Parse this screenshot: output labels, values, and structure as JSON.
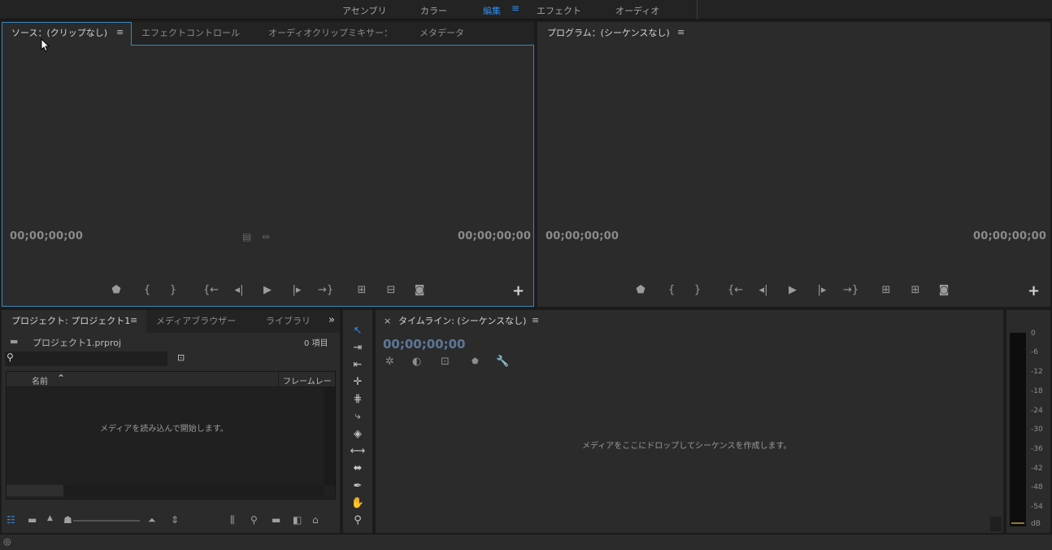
{
  "workspaces": {
    "tabs": [
      "アセンブリ",
      "カラー",
      "編集",
      "エフェクト",
      "オーディオ"
    ],
    "active": "編集",
    "menu_icon": "hamburger-icon"
  },
  "source_monitor": {
    "tabs": [
      "ソース：(クリップなし)",
      "エフェクトコントロール",
      "オーディオクリップミキサー：",
      "メタデータ"
    ],
    "tab_menu": "≡",
    "timecode_in": "00;00;00;00",
    "timecode_out": "00;00;00;00"
  },
  "program_monitor": {
    "title": "プログラム：(シーケンスなし)",
    "tab_menu": "≡",
    "timecode_in": "00;00;00;00",
    "timecode_out": "00;00;00;00"
  },
  "project_panel": {
    "tabs": [
      "プロジェクト: プロジェクト1",
      "メディアブラウザー",
      "ライブラリ"
    ],
    "tab_menu": "≡",
    "overflow": "»",
    "file_name": "プロジェクト1.prproj",
    "item_count": "0 項目",
    "column_name": "名前",
    "column_framerate": "フレームレー",
    "empty_message": "メディアを読み込んで開始します。"
  },
  "timeline": {
    "close": "×",
    "title": "タイムライン: (シーケンスなし)",
    "tab_menu": "≡",
    "timecode": "00;00;00;00",
    "empty_message": "メディアをここにドロップしてシーケンスを作成します。"
  },
  "audio_meter": {
    "labels": [
      "0",
      "-6",
      "-12",
      "-18",
      "-24",
      "-30",
      "-36",
      "-42",
      "-48",
      "-54",
      "dB"
    ]
  },
  "colors": {
    "accent": "#2d8ceb",
    "panel_bg": "#2b2b2b",
    "focus_border": "#3e86b8"
  }
}
